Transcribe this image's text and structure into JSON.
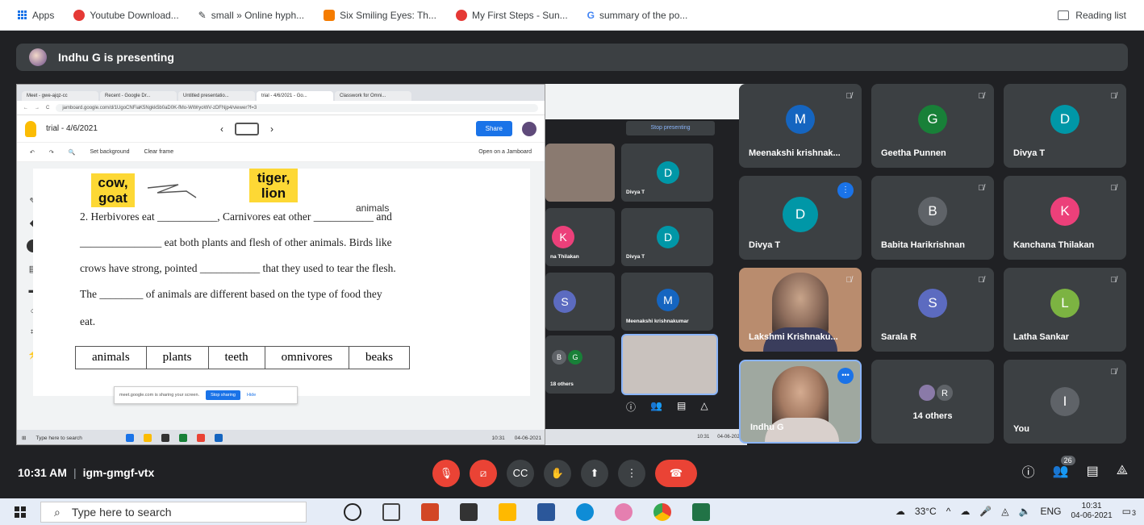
{
  "bookmarks": {
    "apps_label": "Apps",
    "items": [
      {
        "label": "Youtube Download...",
        "icon": "youtube-red-icon",
        "color": "#e53935"
      },
      {
        "label": "small » Online hyph...",
        "icon": "pencil-icon",
        "color": "#333333"
      },
      {
        "label": "Six Smiling Eyes: Th...",
        "icon": "blogger-icon",
        "color": "#f57c00"
      },
      {
        "label": "My First Steps - Sun...",
        "icon": "search-red-icon",
        "color": "#e53935"
      },
      {
        "label": "summary of the po...",
        "icon": "google-icon",
        "color": "#4285f4"
      }
    ],
    "reading_list": "Reading list"
  },
  "presenting": {
    "text": "Indhu G is presenting"
  },
  "shared_screen": {
    "tabs": [
      "Meet - gwe-ajqz-cc",
      "Recent - Google Dr...",
      "Untitled presentatio...",
      "trial - 4/6/2021 - Go...",
      "Classwork for Omni..."
    ],
    "url": "jamboard.google.com/d/1UgoCNFiaK5Ngkk5b0aD0K-fMo-WWryoWV-zDFNjp4/viewer?f=3",
    "jam_title": "trial - 4/6/2021",
    "share_label": "Share",
    "toolbar": {
      "set_background": "Set background",
      "clear_frame": "Clear frame",
      "open_jamboard": "Open on a Jamboard"
    },
    "stickies": [
      {
        "text": "cow,\ngoat"
      },
      {
        "text": "tiger,\nlion"
      }
    ],
    "lines": [
      "2. Herbivores eat ___________, Carnivores eat other ___________ and",
      "_______________ eat both plants and flesh of other animals. Birds like",
      "crows have strong, pointed ___________ that they used to tear the flesh.",
      "The ________ of animals are different based on the type of food they",
      "eat."
    ],
    "handwritten": "animals",
    "words": [
      "animals",
      "plants",
      "teeth",
      "omnivores",
      "beaks"
    ],
    "notice": {
      "text": "meet.google.com is sharing your screen.",
      "stop": "Stop sharing",
      "hide": "Hide"
    },
    "taskbar_search": "Type here to search",
    "taskbar_time": "10:31",
    "taskbar_date": "04-06-2021"
  },
  "middle_window": {
    "stop_presenting": "Stop presenting",
    "tiles": [
      {
        "name": "Divya T",
        "initial": "D",
        "color": "#0097a7"
      },
      {
        "name": "na Thilakan",
        "initial": "K",
        "color": "#ec407a"
      },
      {
        "name": "Divya T",
        "initial": "D",
        "color": "#0097a7"
      },
      {
        "name": "",
        "initial": "S",
        "color": "#5c6bc0"
      },
      {
        "name": "Meenakshi krishnakumar",
        "initial": "M",
        "color": "#1565c0"
      },
      {
        "name": "18 others",
        "initial": "",
        "color": "#5f6368"
      }
    ],
    "others_initials": [
      "B",
      "G"
    ],
    "time": "10:31",
    "date": "04-06-2021"
  },
  "participants": [
    {
      "name": "Meenakshi krishnak...",
      "initial": "M",
      "color": "#1565c0",
      "muted": true
    },
    {
      "name": "Geetha Punnen",
      "initial": "G",
      "color": "#188038",
      "muted": true
    },
    {
      "name": "Divya T",
      "initial": "D",
      "color": "#0097a7",
      "muted": true
    },
    {
      "name": "Divya T",
      "initial": "D",
      "color": "#0097a7",
      "muted": false,
      "speaking": true
    },
    {
      "name": "Babita Harikrishnan",
      "initial": "B",
      "color": "#5f6368",
      "muted": true
    },
    {
      "name": "Kanchana Thilakan",
      "initial": "K",
      "color": "#ec407a",
      "muted": true
    },
    {
      "name": "Lakshmi Krishnaku...",
      "video": true,
      "muted": true
    },
    {
      "name": "Sarala R",
      "initial": "S",
      "color": "#5c6bc0",
      "muted": true
    },
    {
      "name": "Latha Sankar",
      "initial": "L",
      "color": "#7cb342",
      "muted": true
    },
    {
      "name": "Indhu G",
      "video": true,
      "muted": false
    },
    {
      "name": "14 others",
      "others": [
        "R"
      ]
    },
    {
      "name": "You",
      "initial": "I",
      "color": "#5f6368",
      "muted": true
    }
  ],
  "meeting": {
    "time": "10:31 AM",
    "code": "igm-gmgf-vtx",
    "participant_count": "26"
  },
  "windows": {
    "search_placeholder": "Type here to search",
    "temperature": "33°C",
    "lang": "ENG",
    "time": "10:31",
    "date": "04-06-2021",
    "notifications": "3"
  }
}
